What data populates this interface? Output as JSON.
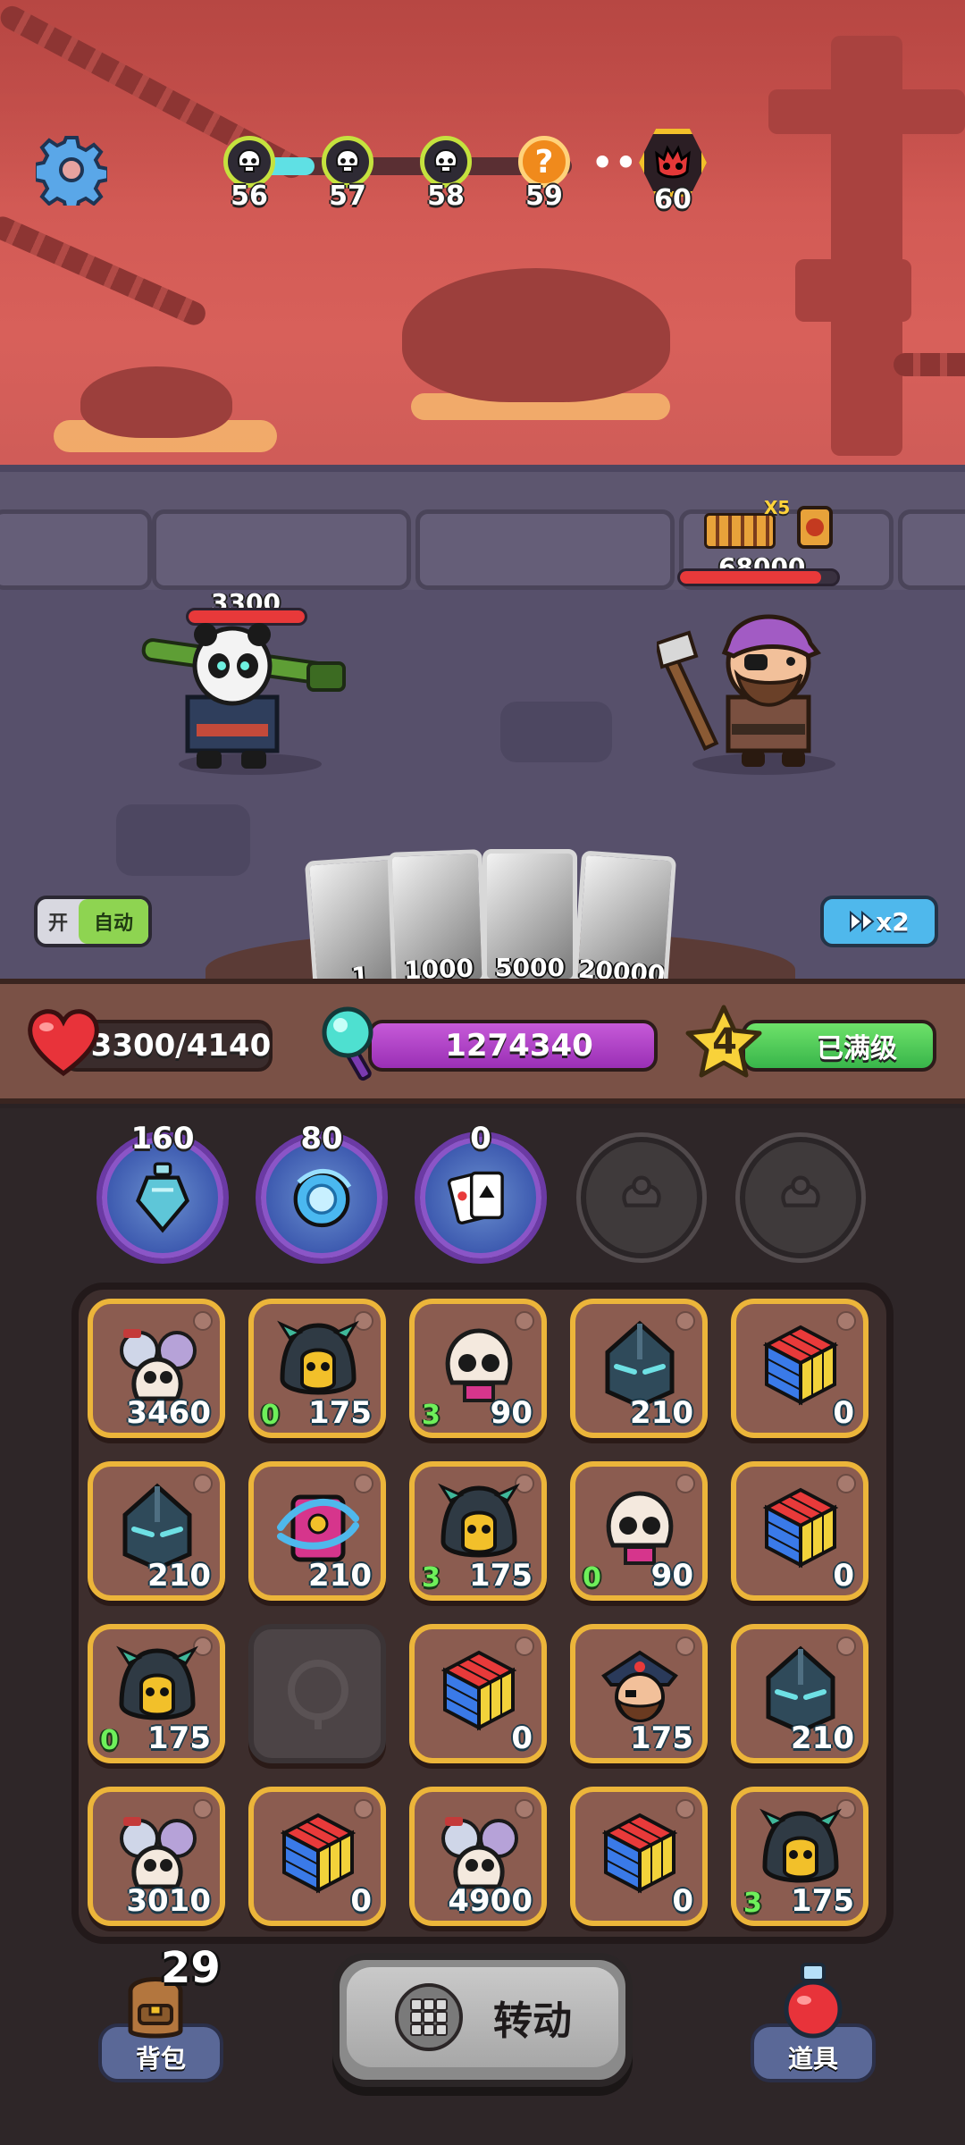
{
  "wave": {
    "nodes": [
      {
        "label": "56",
        "kind": "skull"
      },
      {
        "label": "57",
        "kind": "skull"
      },
      {
        "label": "58",
        "kind": "skull"
      },
      {
        "label": "59",
        "kind": "question"
      }
    ],
    "boss_label": "60",
    "dots": "•••",
    "progress": 0.2
  },
  "player": {
    "hp_text": "3300",
    "hp_fraction": 1.0
  },
  "enemy": {
    "hp_text": "68000",
    "hp_fraction": 0.9,
    "buff_count": "X5"
  },
  "cards": [
    {
      "value": "1"
    },
    {
      "value": "1000"
    },
    {
      "value": "5000"
    },
    {
      "value": "20000"
    }
  ],
  "auto_toggle": {
    "off_label": "开",
    "on_label": "自动"
  },
  "speed_button": {
    "label": "x2"
  },
  "stats": {
    "hp": "3300/4140",
    "mana": "1274340",
    "level": "4",
    "level_status": "已满级"
  },
  "slots": [
    {
      "count": "160",
      "active": true,
      "icon": "potion-icon"
    },
    {
      "count": "80",
      "active": true,
      "icon": "orb-icon"
    },
    {
      "count": "0",
      "active": true,
      "icon": "cards-icon"
    },
    {
      "count": "",
      "active": false,
      "icon": "locked-slot-icon"
    },
    {
      "count": "",
      "active": false,
      "icon": "locked-slot-icon"
    }
  ],
  "tiles": [
    {
      "icon": "skull-group-icon",
      "value": "3460",
      "level": ""
    },
    {
      "icon": "hooded-skull-icon",
      "value": "175",
      "level": "0"
    },
    {
      "icon": "skull-icon",
      "value": "90",
      "level": "3"
    },
    {
      "icon": "helmet-icon",
      "value": "210",
      "level": ""
    },
    {
      "icon": "rubik-cube-icon",
      "value": "0",
      "level": ""
    },
    {
      "icon": "helmet-icon",
      "value": "210",
      "level": ""
    },
    {
      "icon": "spellbook-icon",
      "value": "210",
      "level": ""
    },
    {
      "icon": "hooded-skull-icon",
      "value": "175",
      "level": "3"
    },
    {
      "icon": "skull-icon",
      "value": "90",
      "level": "0"
    },
    {
      "icon": "rubik-cube-icon",
      "value": "0",
      "level": ""
    },
    {
      "icon": "hooded-skull-icon",
      "value": "175",
      "level": "0"
    },
    {
      "icon": "empty-icon",
      "value": "",
      "level": ""
    },
    {
      "icon": "rubik-cube-icon",
      "value": "0",
      "level": ""
    },
    {
      "icon": "pirate-icon",
      "value": "175",
      "level": ""
    },
    {
      "icon": "helmet-icon",
      "value": "210",
      "level": ""
    },
    {
      "icon": "skull-group-icon",
      "value": "3010",
      "level": ""
    },
    {
      "icon": "rubik-cube-icon",
      "value": "0",
      "level": ""
    },
    {
      "icon": "skull-group-icon",
      "value": "4900",
      "level": ""
    },
    {
      "icon": "rubik-cube-icon",
      "value": "0",
      "level": ""
    },
    {
      "icon": "hooded-skull-icon",
      "value": "175",
      "level": "3"
    }
  ],
  "bottom": {
    "bag_label": "背包",
    "bag_count": "29",
    "spin_label": "转动",
    "items_label": "道具"
  }
}
